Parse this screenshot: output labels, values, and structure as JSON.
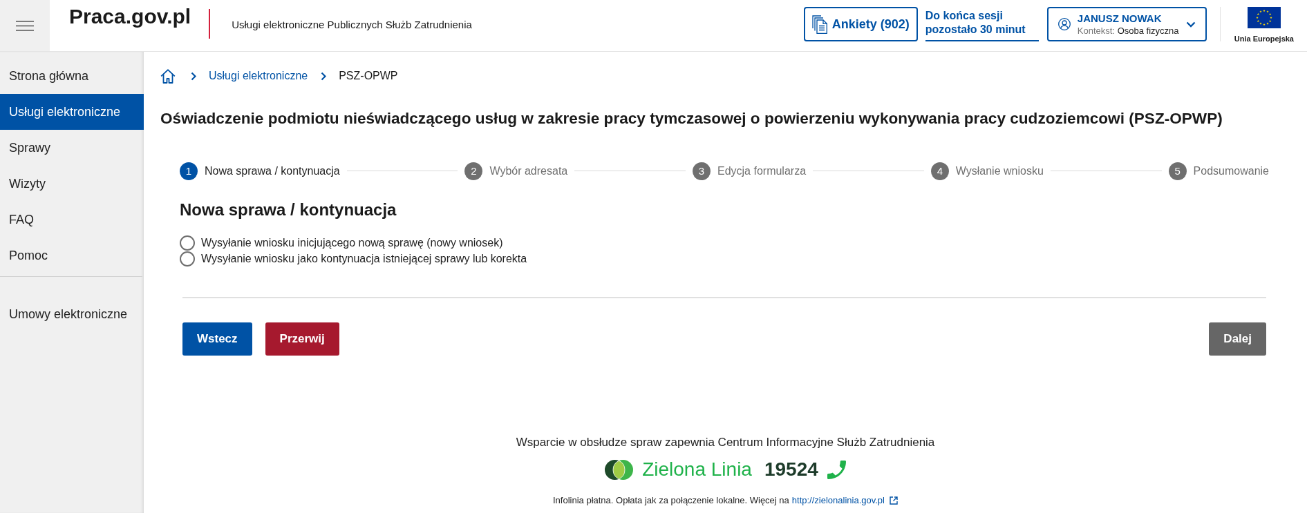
{
  "header": {
    "logo": "Praca.gov.pl",
    "subtitle": "Usługi elektroniczne Publicznych Służb Zatrudnienia",
    "surveys_button": "Ankiety (902)",
    "session": "Do końca sesji pozostało 30 minut",
    "user": {
      "name": "JANUSZ NOWAK",
      "context_label": "Kontekst:",
      "context_value": "Osoba fizyczna"
    },
    "flag_caption": "Unia Europejska"
  },
  "sidebar": {
    "items": [
      {
        "label": "Strona główna",
        "selected": false
      },
      {
        "label": "Usługi elektroniczne",
        "selected": true
      },
      {
        "label": "Sprawy",
        "selected": false
      },
      {
        "label": "Wizyty",
        "selected": false
      },
      {
        "label": "FAQ",
        "selected": false
      },
      {
        "label": "Pomoc",
        "selected": false
      }
    ],
    "bottom_items": [
      {
        "label": "Umowy elektroniczne",
        "selected": false
      }
    ]
  },
  "breadcrumb": [
    {
      "label": "Usługi elektroniczne",
      "kind": "link"
    },
    {
      "label": "PSZ-OPWP",
      "kind": "current"
    }
  ],
  "page_title": "Oświadczenie podmiotu nieświadczącego usług w zakresie pracy tymczasowej o powierzeniu wykonywania pracy cudzoziemcowi (PSZ-OPWP)",
  "stepper": [
    {
      "number": "1",
      "label": "Nowa sprawa / kontynuacja",
      "selected": true
    },
    {
      "number": "2",
      "label": "Wybór adresata",
      "selected": false
    },
    {
      "number": "3",
      "label": "Edycja formularza",
      "selected": false
    },
    {
      "number": "4",
      "label": "Wysłanie wniosku",
      "selected": false
    },
    {
      "number": "5",
      "label": "Podsumowanie",
      "selected": false
    }
  ],
  "form": {
    "title": "Nowa sprawa / kontynuacja",
    "options": [
      {
        "label": "Wysyłanie wniosku inicjującego nową sprawę (nowy wniosek)",
        "selected": false
      },
      {
        "label": "Wysyłanie wniosku jako kontynuacja istniejącej sprawy lub korekta",
        "selected": false
      }
    ]
  },
  "buttons": [
    {
      "label": "Wstecz",
      "kind": "back"
    },
    {
      "label": "Przerwij",
      "kind": "cancel"
    },
    {
      "label": "Dalej",
      "kind": "next"
    }
  ],
  "footer": {
    "support_text": "Wsparcie w obsłudze spraw zapewnia Centrum Informacyjne Służb Zatrudnienia",
    "hotline_name": "Zielona Linia",
    "hotline_number": "19524",
    "note": "Infolinia płatna. Opłata jak za połączenie lokalne. Więcej na",
    "note_link": "http://zielonalinia.gov.pl"
  }
}
